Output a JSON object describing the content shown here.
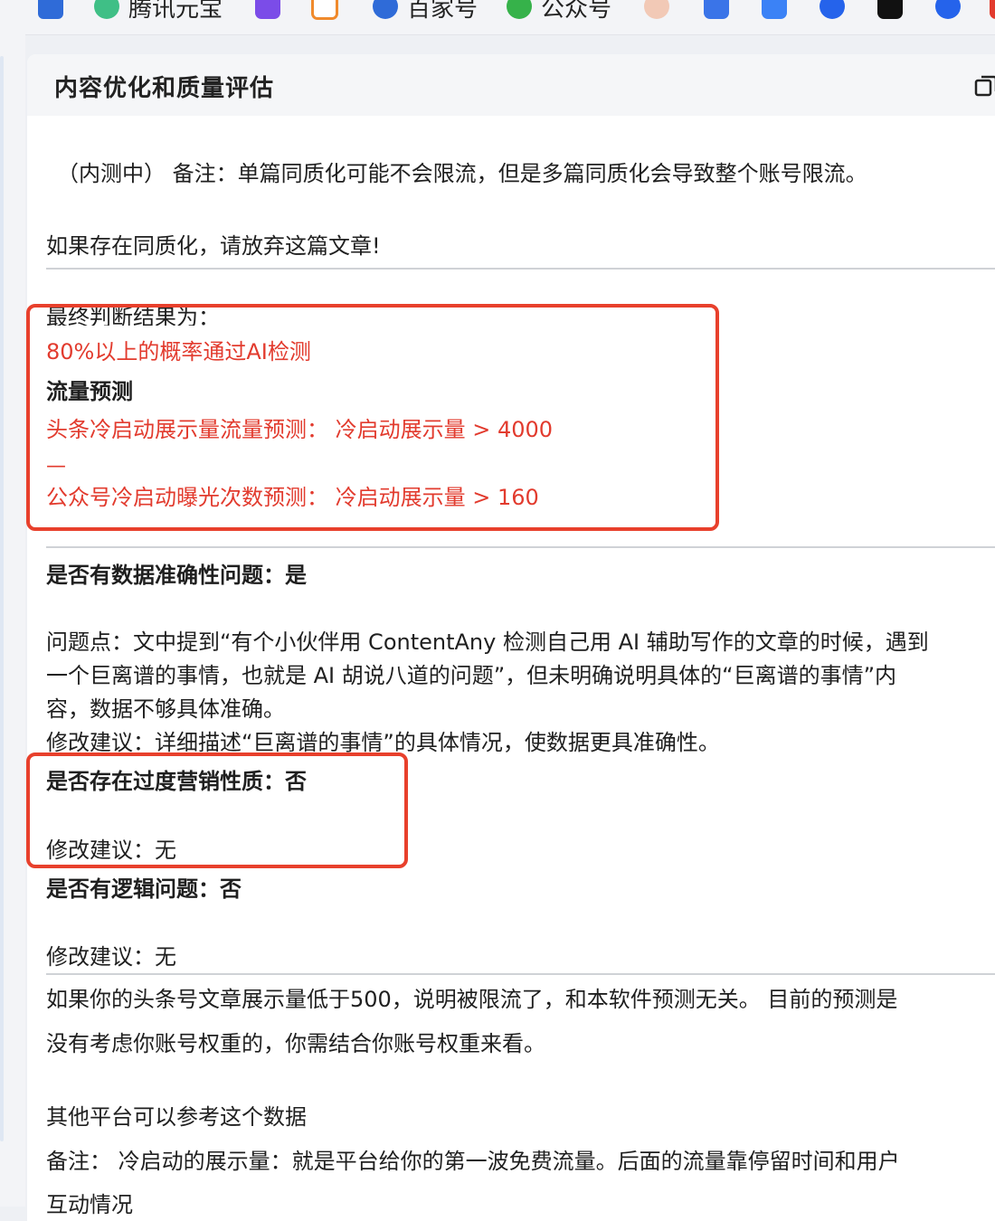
{
  "bookmarks": [
    {
      "icon": "shield-bookmark-icon",
      "label": "",
      "color": "#2f6bd8"
    },
    {
      "icon": "tencent-yuanbao-icon",
      "label": "腾讯元宝",
      "color": "#3fbf86"
    },
    {
      "icon": "purple-app-icon",
      "label": "",
      "color": "#7b4ce8"
    },
    {
      "icon": "orange-doc-icon",
      "label": "",
      "color": "#f08a2c"
    },
    {
      "icon": "baijiahao-icon",
      "label": "百家号",
      "color": "#2f6bd8"
    },
    {
      "icon": "wechat-official-icon",
      "label": "公众号",
      "color": "#36b24a"
    },
    {
      "icon": "avatar-bookmark-icon",
      "label": "",
      "color": "#f2c9b6"
    },
    {
      "icon": "blue-pen-icon",
      "label": "",
      "color": "#3a74e8"
    },
    {
      "icon": "robot-icon",
      "label": "",
      "color": "#3b82f6"
    },
    {
      "icon": "blue-d-icon",
      "label": "",
      "color": "#2563eb"
    },
    {
      "icon": "black-app-icon",
      "label": "",
      "color": "#111111"
    },
    {
      "icon": "blue-d-icon-2",
      "label": "",
      "color": "#2563eb"
    },
    {
      "icon": "red-app-icon",
      "label": "",
      "color": "#e23b2e"
    }
  ],
  "panel": {
    "title": "内容优化和质量评估",
    "copy_icon": "copy-icon"
  },
  "content": {
    "note_line": "（内测中） 备注：单篇同质化可能不会限流，但是多篇同质化会导致整个账号限流。",
    "warning_line": "如果存在同质化，请放弃这篇文章!",
    "final_label": "最终判断结果为：",
    "final_result": "80%以上的概率通过AI检测",
    "traffic_heading": "流量预测",
    "toutiao_prediction": "头条冷启动展示量流量预测：  冷启动展示量 > 4000",
    "dash": "—",
    "gzh_prediction": "公众号冷启动曝光次数预测：  冷启动展示量 > 160",
    "accuracy_heading": "是否有数据准确性问题：是",
    "accuracy_issue_1": "问题点：文中提到“有个小伙伴用 ContentAny 检测自己用 AI 辅助写作的文章的时候，遇到",
    "accuracy_issue_2": "一个巨离谱的事情，也就是 AI 胡说八道的问题”，但未明确说明具体的“巨离谱的事情”内",
    "accuracy_issue_3": "容，数据不够具体准确。",
    "accuracy_suggestion": "修改建议：详细描述“巨离谱的事情”的具体情况，使数据更具准确性。",
    "marketing_heading": "是否存在过度营销性质：否",
    "marketing_suggestion": "修改建议：无",
    "logic_heading": "是否有逻辑问题：否",
    "logic_suggestion": "修改建议：无",
    "limit_note_1": "如果你的头条号文章展示量低于500，说明被限流了，和本软件预测无关。 目前的预测是",
    "limit_note_2": "没有考虑你账号权重的，你需结合你账号权重来看。",
    "other_platform": "其他平台可以参考这个数据",
    "remark_1": "备注：  冷启动的展示量：就是平台给你的第一波免费流量。后面的流量靠停留时间和用户",
    "remark_2": "互动情况"
  },
  "colors": {
    "highlight": "#e23b2e",
    "box": "#e8402c"
  }
}
